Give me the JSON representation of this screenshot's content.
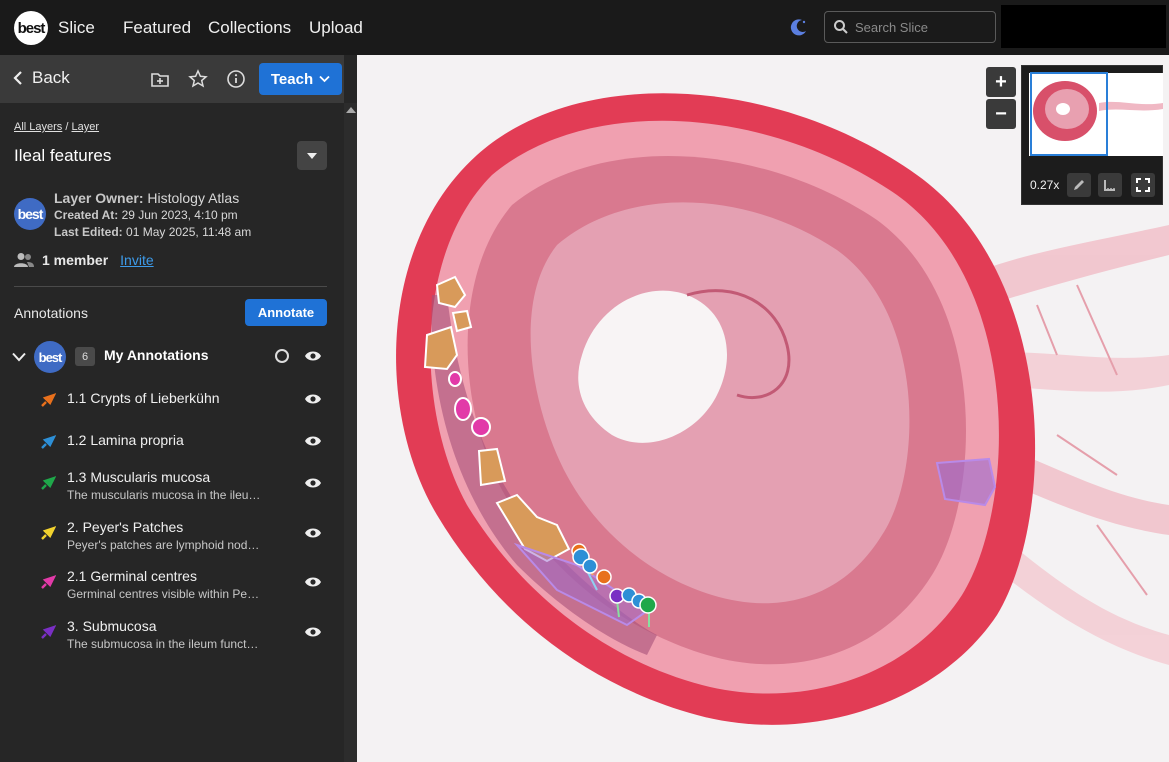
{
  "app": {
    "logo_text": "best",
    "brand": "Slice",
    "nav": [
      "Featured",
      "Collections",
      "Upload"
    ],
    "search_placeholder": "Search Slice"
  },
  "sidebar": {
    "back_label": "Back",
    "teach_label": "Teach",
    "breadcrumb": {
      "root": "All Layers",
      "sep": "/",
      "current": "Layer"
    },
    "layer_title": "Ileal features",
    "owner_label": "Layer Owner:",
    "owner_value": "Histology Atlas",
    "created_label": "Created At:",
    "created_value": "29 Jun 2023, 4:10 pm",
    "edited_label": "Last Edited:",
    "edited_value": "01 May 2025, 11:48 am",
    "members_text": "1 member",
    "invite_label": "Invite",
    "annotations_label": "Annotations",
    "annotate_label": "Annotate",
    "group": {
      "count": "6",
      "title": "My Annotations"
    },
    "items": [
      {
        "title": "1.1 Crypts of Lieberkühn",
        "desc": "",
        "color": "#e8701c"
      },
      {
        "title": "1.2 Lamina propria",
        "desc": "",
        "color": "#2d8fd6"
      },
      {
        "title": "1.3 Muscularis mucosa",
        "desc": "The muscularis mucosa in the ileu…",
        "color": "#1fa84a"
      },
      {
        "title": "2. Peyer's Patches",
        "desc": "Peyer's patches are lymphoid nod…",
        "color": "#f2d22e"
      },
      {
        "title": "2.1 Germinal centres",
        "desc": "Germinal centres visible within Pe…",
        "color": "#e23aa8"
      },
      {
        "title": "3. Submucosa",
        "desc": "The submucosa in the ileum funct…",
        "color": "#7a2fc4"
      }
    ]
  },
  "viewer": {
    "zoom_in": "+",
    "zoom_out": "−",
    "zoom_level": "0.27x"
  }
}
